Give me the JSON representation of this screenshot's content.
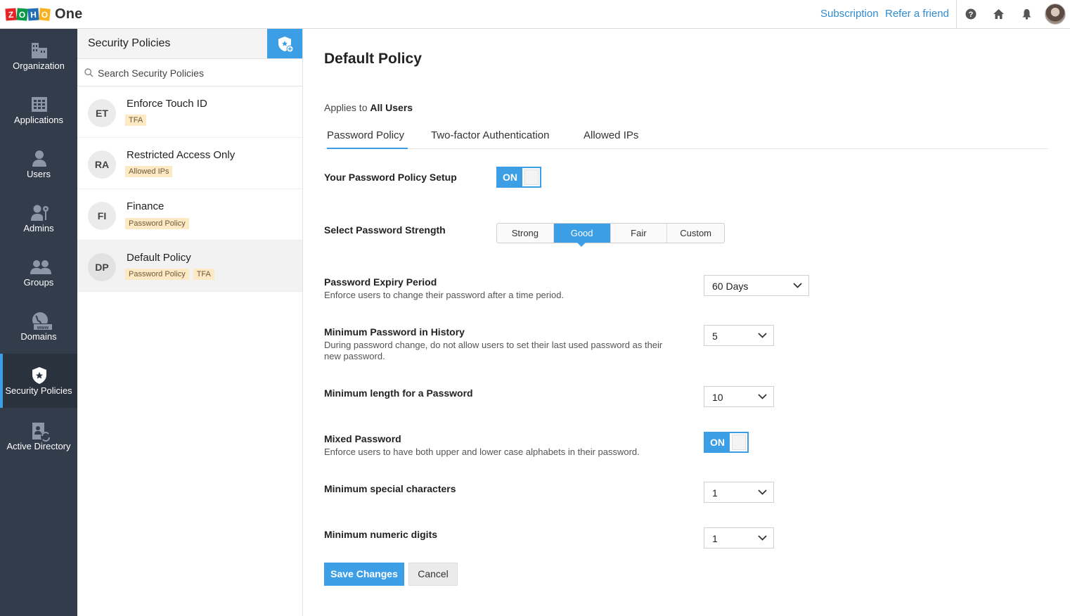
{
  "app": {
    "logo_letters": [
      "Z",
      "O",
      "H",
      "O"
    ],
    "logo_product": "One",
    "links": {
      "subscription": "Subscription",
      "refer": "Refer a friend"
    }
  },
  "nav": {
    "items": [
      {
        "label": "Organization",
        "icon": "organization-icon"
      },
      {
        "label": "Applications",
        "icon": "applications-icon"
      },
      {
        "label": "Users",
        "icon": "user-icon"
      },
      {
        "label": "Admins",
        "icon": "admin-icon"
      },
      {
        "label": "Groups",
        "icon": "groups-icon"
      },
      {
        "label": "Domains",
        "icon": "domains-icon"
      },
      {
        "label": "Security Policies",
        "icon": "shield-icon",
        "active": true
      },
      {
        "label": "Active Directory",
        "icon": "active-directory-icon"
      }
    ]
  },
  "list": {
    "title": "Security Policies",
    "search_placeholder": "Search Security Policies",
    "policies": [
      {
        "initials": "ET",
        "name": "Enforce Touch ID",
        "tags": [
          "TFA"
        ]
      },
      {
        "initials": "RA",
        "name": "Restricted Access Only",
        "tags": [
          "Allowed IPs"
        ]
      },
      {
        "initials": "FI",
        "name": "Finance",
        "tags": [
          "Password Policy"
        ]
      },
      {
        "initials": "DP",
        "name": "Default Policy",
        "tags": [
          "Password Policy",
          "TFA"
        ],
        "selected": true
      }
    ]
  },
  "main": {
    "title": "Default Policy",
    "applies_prefix": "Applies to",
    "applies_target": "All Users",
    "tabs": [
      "Password Policy",
      "Two-factor Authentication",
      "Allowed IPs"
    ],
    "active_tab": 0,
    "setup": {
      "label": "Your Password Policy Setup",
      "toggle": "ON"
    },
    "strength": {
      "label": "Select Password Strength",
      "options": [
        "Strong",
        "Good",
        "Fair",
        "Custom"
      ],
      "selected": "Good"
    },
    "expiry": {
      "label": "Password Expiry Period",
      "desc": "Enforce users to change their password after a time period.",
      "value": "60 Days"
    },
    "history": {
      "label": "Minimum Password in History",
      "desc": "During password change, do not allow users to set their last used password as their new password.",
      "value": "5"
    },
    "min_length": {
      "label": "Minimum length for a Password",
      "value": "10"
    },
    "mixed": {
      "label": "Mixed Password",
      "desc": "Enforce users to have both upper and lower case alphabets in their password.",
      "toggle": "ON"
    },
    "special": {
      "label": "Minimum special characters",
      "value": "1"
    },
    "numeric": {
      "label": "Minimum numeric digits",
      "value": "1"
    },
    "save_label": "Save Changes",
    "cancel_label": "Cancel"
  },
  "colors": {
    "accent": "#3c9ee5",
    "nav_bg": "#333c4a",
    "tag_bg": "#fde9c4"
  }
}
